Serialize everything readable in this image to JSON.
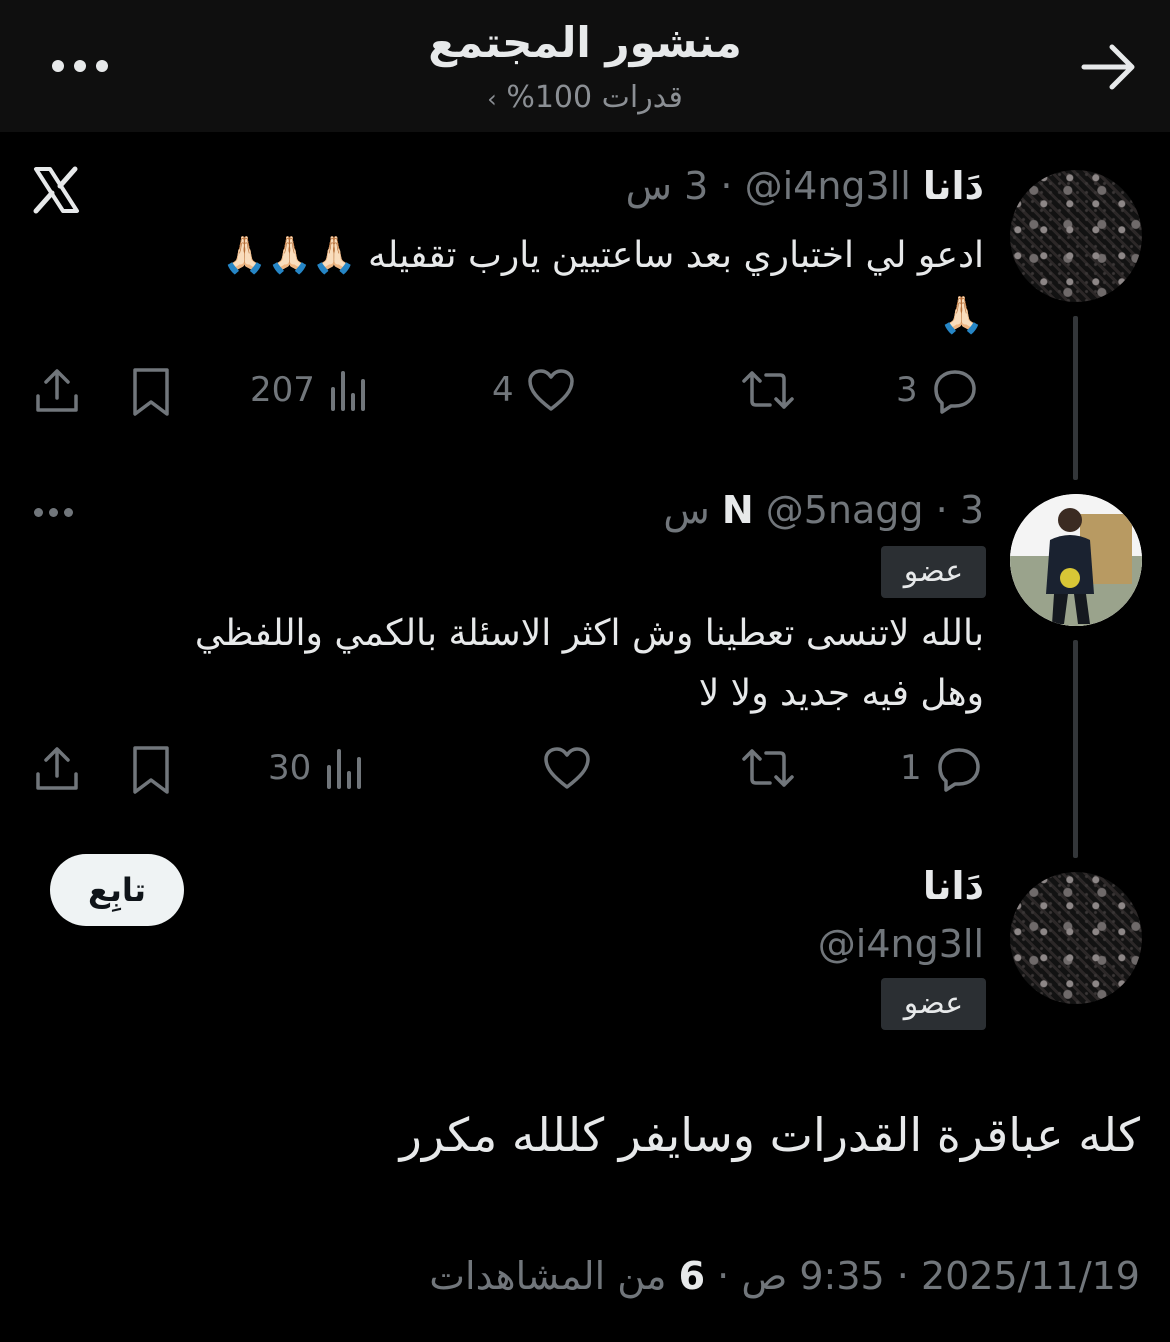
{
  "header": {
    "title": "منشور المجتمع",
    "community": "قدرات 100%",
    "chevron": "›",
    "back_icon": "arrow-right-icon",
    "more_icon": "more-horizontal-icon"
  },
  "posts": [
    {
      "display_name": "دَانا",
      "handle": "@i4ng3ll",
      "time": "3 س",
      "text_line1": "ادعو لي اختباري بعد ساعتيين يارب تقفيله 🙏🏻🙏🏻🙏🏻",
      "text_line2": "🙏🏻",
      "replies": "3",
      "retweets": "",
      "likes": "4",
      "views": "207",
      "source_icon": "x-logo-icon"
    },
    {
      "display_name": "N",
      "handle": "@5nagg",
      "time": "3 س",
      "badge": "عضو",
      "text_line1": "بالله لاتنسى تعطينا وش اكثر الاسئلة بالكمي واللفظي",
      "text_line2": "وهل فيه جديد ولا لا",
      "replies": "1",
      "retweets": "",
      "likes": "",
      "views": "30"
    }
  ],
  "main_post": {
    "display_name": "دَانا",
    "handle": "@i4ng3ll",
    "badge": "عضو",
    "follow_label": "تابِع",
    "text": "كله عباقرة القدرات وسايفر كللله مكرر",
    "date": "2025/11/19",
    "time": "9:35 ص",
    "views_count": "6",
    "views_label": "من المشاهدات"
  },
  "colors": {
    "background": "#000000",
    "header_bg": "#0f0f0f",
    "text": "#e7e9ea",
    "muted": "#71767b",
    "badge_bg": "#2b2f33",
    "follow_bg": "#eff3f4"
  }
}
